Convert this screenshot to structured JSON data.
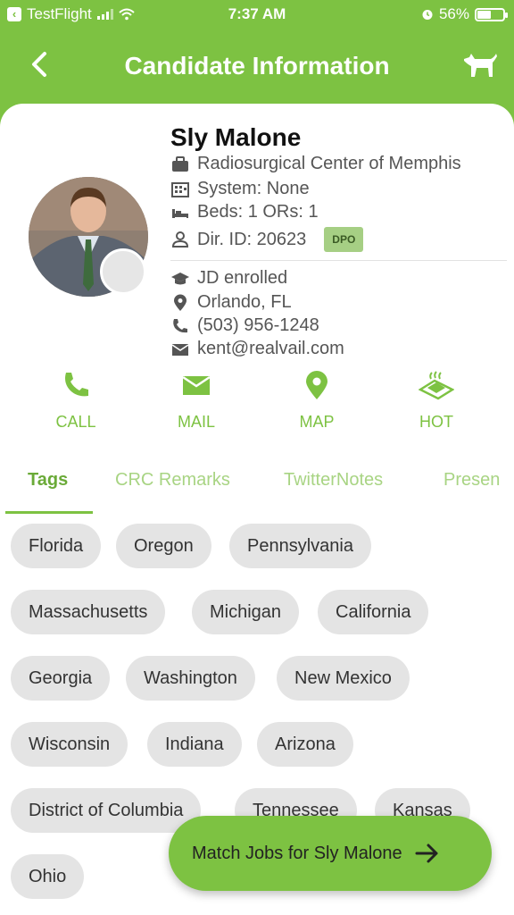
{
  "status": {
    "carrier": "TestFlight",
    "time": "7:37 AM",
    "battery": "56%",
    "battery_level": 0.56
  },
  "nav": {
    "title": "Candidate Information"
  },
  "candidate": {
    "name": "Sly Malone",
    "facility": "Radiosurgical Center of Memphis",
    "system": "System: None",
    "beds": "Beds: 1 ORs: 1",
    "dir_id": "Dir. ID: 20623",
    "badge": "DPO",
    "education": "JD enrolled",
    "location": "Orlando, FL",
    "phone": "(503) 956-1248",
    "email": "kent@realvail.com"
  },
  "actions": [
    {
      "label": "CALL",
      "icon": "phone-icon"
    },
    {
      "label": "MAIL",
      "icon": "mail-icon"
    },
    {
      "label": "MAP",
      "icon": "map-pin-icon"
    },
    {
      "label": "HOT",
      "icon": "hot-icon"
    }
  ],
  "tabs": [
    "Tags",
    "CRC Remarks",
    "TwitterNotes",
    "Presen"
  ],
  "tags": [
    "Florida",
    "Oregon",
    "Pennsylvania",
    "Massachusetts",
    "Michigan",
    "California",
    "Georgia",
    "Washington",
    "New Mexico",
    "Wisconsin",
    "Indiana",
    "Arizona",
    "District of Columbia",
    "Tennessee",
    "Kansas",
    "Ohio"
  ],
  "fab": {
    "label": "Match Jobs for Sly Malone"
  },
  "colors": {
    "brand": "#7dc242",
    "chip": "#e4e4e4"
  }
}
